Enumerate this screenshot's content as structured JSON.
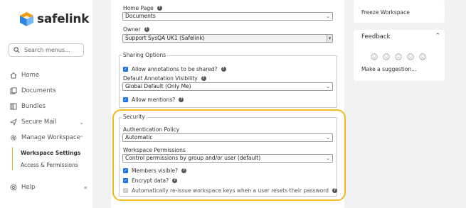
{
  "brand": {
    "name": "safelink"
  },
  "search": {
    "placeholder": "Search menus..."
  },
  "nav": {
    "home": "Home",
    "documents": "Documents",
    "bundles": "Bundles",
    "secure_mail": "Secure Mail",
    "manage_workspace": "Manage Workspace",
    "workspace_settings": "Workspace Settings",
    "access_permissions": "Access & Permissions",
    "help": "Help"
  },
  "form": {
    "home_page": {
      "label": "Home Page",
      "value": "Documents"
    },
    "owner": {
      "label": "Owner",
      "value": "Support SysQA UK1 (Safelink)"
    },
    "sharing": {
      "legend": "Sharing Options",
      "allow_annotations": "Allow annotations to be shared?",
      "default_visibility_label": "Default Annotation Visibility",
      "default_visibility_value": "Global Default (Only Me)",
      "allow_mentions": "Allow mentions?"
    },
    "security": {
      "legend": "Security",
      "auth_policy_label": "Authentication Policy",
      "auth_policy_value": "Automatic",
      "permissions_label": "Workspace Permissions",
      "permissions_value": "Control permissions by group and/or user (default)",
      "members_visible": "Members visible?",
      "encrypt_data": "Encrypt data?",
      "reissue_keys": "Automatically re-issue workspace keys when a user resets their password"
    }
  },
  "right": {
    "freeze": "Freeze Workspace",
    "feedback_title": "Feedback",
    "suggestion": "Make a suggestion..."
  },
  "colors": {
    "accent": "#f4b81f",
    "checkbox": "#1a73e8",
    "logo_orange": "#f39c12",
    "logo_blue": "#2e86de"
  }
}
